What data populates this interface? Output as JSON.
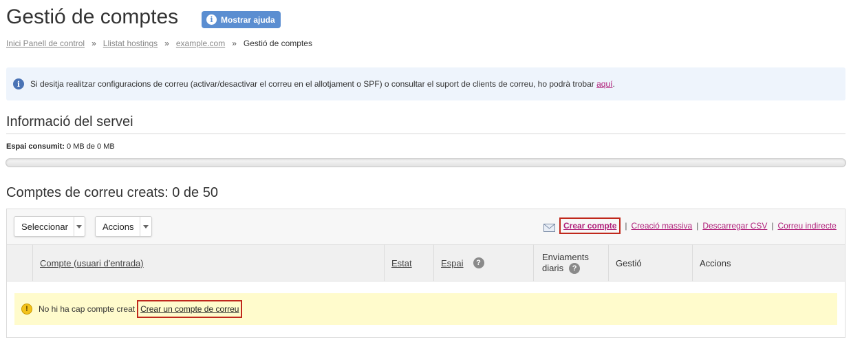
{
  "header": {
    "title": "Gestió de comptes",
    "help_button": "Mostrar ajuda"
  },
  "breadcrumb": {
    "items": [
      "Inici Panell de control",
      "Llistat hostings",
      "example.com"
    ],
    "separator": "»",
    "current": "Gestió de comptes"
  },
  "notice": {
    "text": "Si desitja realitzar configuracions de correu (activar/desactivar el correu en el allotjament o SPF) o consultar el suport de clients de correu, ho podrà trobar",
    "link": "aquí",
    "suffix": "."
  },
  "service": {
    "title": "Informació del servei",
    "usage_label": "Espai consumit:",
    "usage_value": "0 MB de 0 MB",
    "usage_fraction": 0
  },
  "accounts": {
    "title": "Comptes de correu creats: 0 de 50",
    "select_button": "Seleccionar",
    "actions_button": "Accions",
    "links": {
      "create": "Crear compte",
      "bulk": "Creació massiva",
      "csv": "Descarregar CSV",
      "indirect": "Correu indirecte",
      "separator": "|"
    },
    "columns": {
      "account": "Compte (usuari d'entrada)",
      "status": "Estat",
      "space": "Espai",
      "daily_sends_line1": "Enviaments",
      "daily_sends_line2": "diaris",
      "management": "Gestió",
      "actions": "Accions"
    },
    "empty": {
      "text": "No hi ha cap compte creat",
      "link": "Crear un compte de correu"
    }
  },
  "colors": {
    "accent_link": "#b0207a",
    "help_button": "#5b8ed1",
    "highlight_border": "#c0281c",
    "warning_bg": "#fffbcc",
    "info_bg": "#eef4fc"
  },
  "icons": {
    "help": "info-icon",
    "notice": "info-icon",
    "mail": "envelope-icon",
    "question": "question-icon",
    "warning": "warning-icon"
  }
}
